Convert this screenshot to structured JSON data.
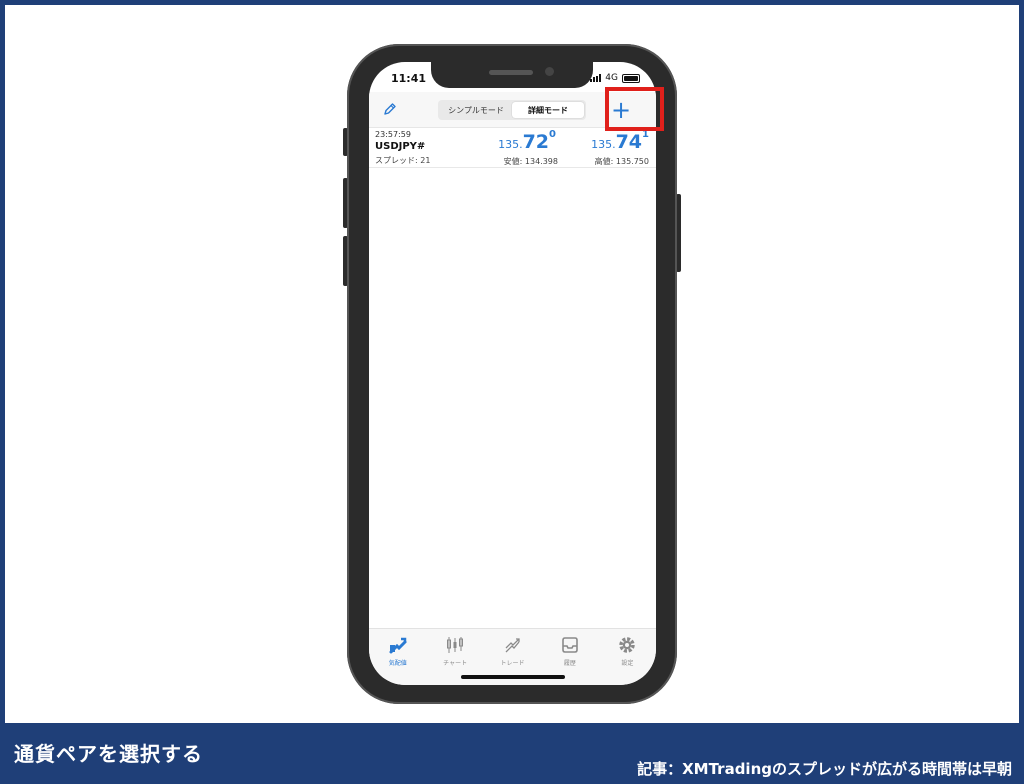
{
  "caption": {
    "left": "通貨ペアを選択する",
    "right": "記事：XMTradingのスプレッドが広がる時間帯は早朝"
  },
  "status_bar": {
    "time": "11:41",
    "network": "4G"
  },
  "header": {
    "modes": [
      "シンプルモード",
      "詳細モード"
    ],
    "active_mode": "詳細モード",
    "add_symbol": "+"
  },
  "quotes": [
    {
      "time": "23:57:59",
      "symbol": "USDJPY#",
      "spread": "スプレッド: 21",
      "bid": {
        "prefix": "135.",
        "big": "72",
        "sup": "0"
      },
      "ask": {
        "prefix": "135.",
        "big": "74",
        "sup": "1"
      },
      "low": "安値: 134.398",
      "high": "高値: 135.750"
    }
  ],
  "tabs": [
    {
      "label": "気配値",
      "icon": "quotes-icon",
      "active": true
    },
    {
      "label": "チャート",
      "icon": "chart-icon",
      "active": false
    },
    {
      "label": "トレード",
      "icon": "trade-icon",
      "active": false
    },
    {
      "label": "履歴",
      "icon": "history-icon",
      "active": false
    },
    {
      "label": "設定",
      "icon": "settings-icon",
      "active": false
    }
  ],
  "colors": {
    "accent": "#2a7ad2",
    "highlight": "#e0201b",
    "banner": "#1f3f78"
  }
}
